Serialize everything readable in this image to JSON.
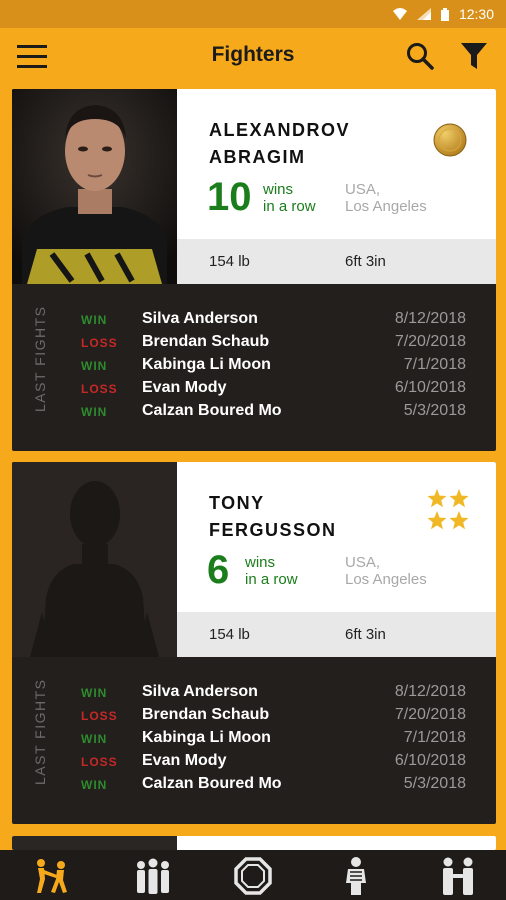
{
  "status_bar": {
    "time": "12:30"
  },
  "app_bar": {
    "title": "Fighters"
  },
  "fighters": [
    {
      "name_line1": "ALEXANDROV",
      "name_line2": "ABRAGIM",
      "streak": "10",
      "streak_label_1": "wins",
      "streak_label_2": "in a row",
      "country": "USA,",
      "city": "Los Angeles",
      "weight": "154 lb",
      "height": "6ft 3in",
      "rank_badge": "gold-medal-icon",
      "last_fights_label": "LAST FIGHTS",
      "fights": [
        {
          "result": "WIN",
          "opponent": "Silva Anderson",
          "date": "8/12/2018"
        },
        {
          "result": "LOSS",
          "opponent": "Brendan Schaub",
          "date": "7/20/2018"
        },
        {
          "result": "WIN",
          "opponent": "Kabinga Li Moon",
          "date": "7/1/2018"
        },
        {
          "result": "LOSS",
          "opponent": "Evan Mody",
          "date": "6/10/2018"
        },
        {
          "result": "WIN",
          "opponent": "Calzan Boured Mo",
          "date": "5/3/2018"
        }
      ]
    },
    {
      "name_line1": "TONY",
      "name_line2": "FERGUSSON",
      "streak": "6",
      "streak_label_1": "wins",
      "streak_label_2": "in a row",
      "country": "USA,",
      "city": "Los Angeles",
      "weight": "154 lb",
      "height": "6ft 3in",
      "rank_badge": "four-stars-icon",
      "last_fights_label": "LAST FIGHTS",
      "fights": [
        {
          "result": "WIN",
          "opponent": "Silva Anderson",
          "date": "8/12/2018"
        },
        {
          "result": "LOSS",
          "opponent": "Brendan Schaub",
          "date": "7/20/2018"
        },
        {
          "result": "WIN",
          "opponent": "Kabinga Li Moon",
          "date": "7/1/2018"
        },
        {
          "result": "LOSS",
          "opponent": "Evan Mody",
          "date": "6/10/2018"
        },
        {
          "result": "WIN",
          "opponent": "Calzan Boured Mo",
          "date": "5/3/2018"
        }
      ]
    }
  ],
  "bottom_nav": [
    {
      "icon": "fighters-kick-icon",
      "active": true
    },
    {
      "icon": "teams-group-icon",
      "active": false
    },
    {
      "icon": "octagon-cage-icon",
      "active": false
    },
    {
      "icon": "referee-icon",
      "active": false
    },
    {
      "icon": "coach-handshake-icon",
      "active": false
    }
  ],
  "colors": {
    "brand": "#f7a91c",
    "win": "#2e8b2e",
    "loss": "#c62828",
    "streak": "#1b7d1b",
    "card_dark": "#231f1c"
  }
}
